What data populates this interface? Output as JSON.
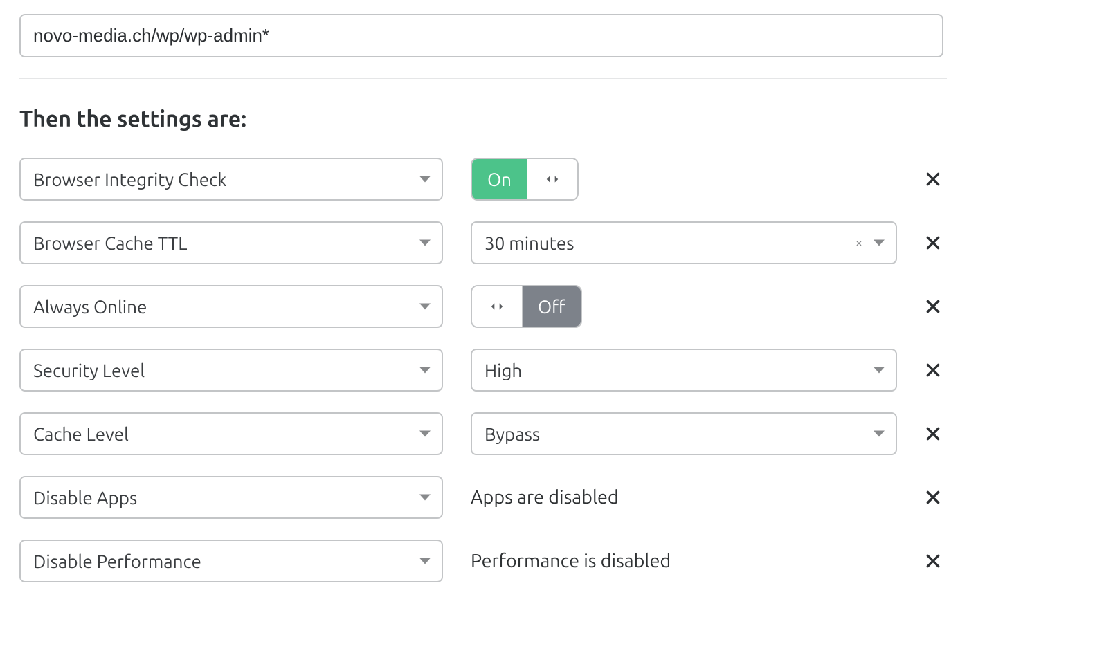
{
  "url_pattern": "novo-media.ch/wp/wp-admin*",
  "section_heading": "Then the settings are:",
  "toggle": {
    "on_label": "On",
    "off_label": "Off"
  },
  "settings": [
    {
      "name": "Browser Integrity Check",
      "type": "toggle",
      "value": "on"
    },
    {
      "name": "Browser Cache TTL",
      "type": "select_clear",
      "value": "30 minutes"
    },
    {
      "name": "Always Online",
      "type": "toggle",
      "value": "off"
    },
    {
      "name": "Security Level",
      "type": "select",
      "value": "High"
    },
    {
      "name": "Cache Level",
      "type": "select",
      "value": "Bypass"
    },
    {
      "name": "Disable Apps",
      "type": "text",
      "value": "Apps are disabled"
    },
    {
      "name": "Disable Performance",
      "type": "text",
      "value": "Performance is disabled"
    }
  ]
}
